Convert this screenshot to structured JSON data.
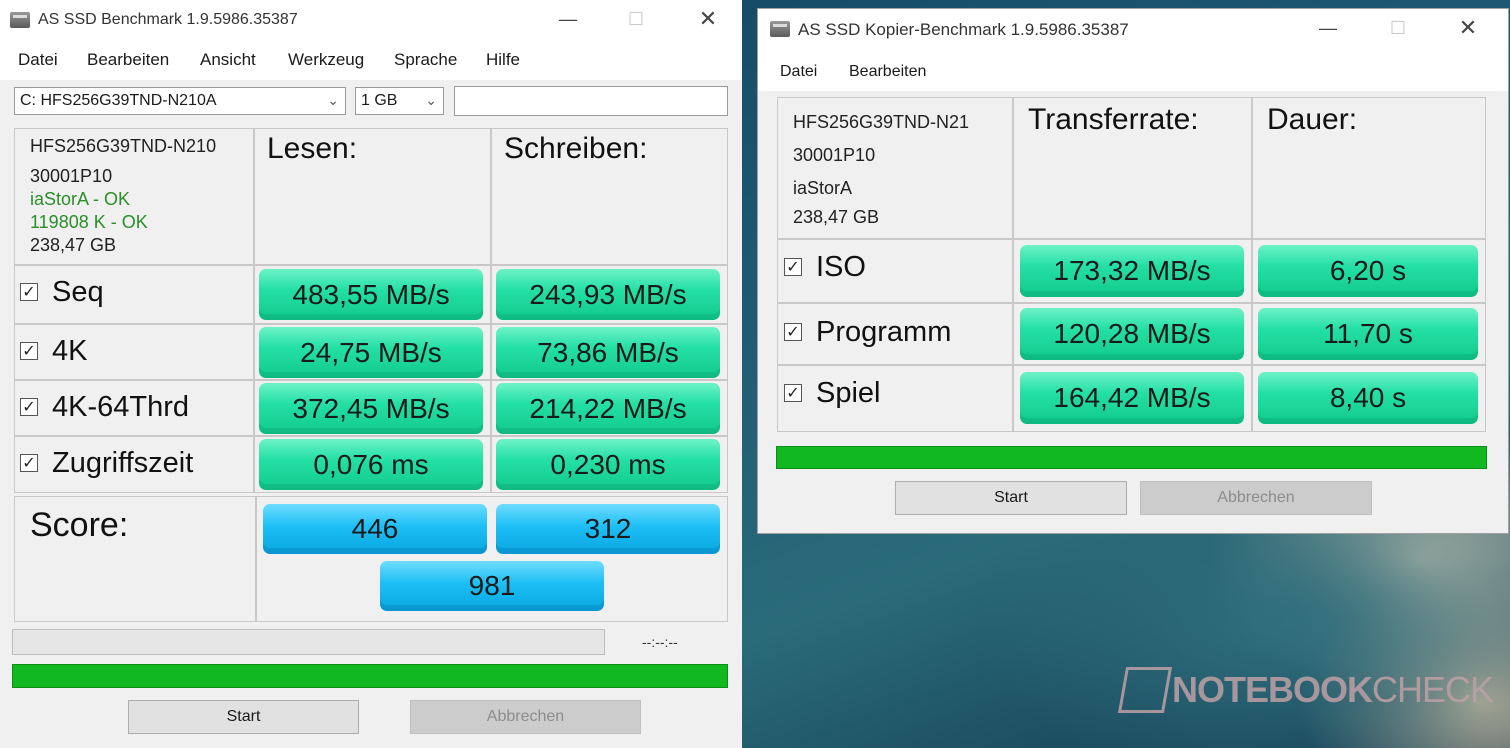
{
  "main": {
    "title": "AS SSD Benchmark 1.9.5986.35387",
    "menu": [
      "Datei",
      "Bearbeiten",
      "Ansicht",
      "Werkzeug",
      "Sprache",
      "Hilfe"
    ],
    "drive_select": "C: HFS256G39TND-N210A",
    "size_select": "1 GB",
    "search_value": "",
    "info": {
      "model": "HFS256G39TND-N210",
      "firmware": "30001P10",
      "driver": "iaStorA - OK",
      "alignment": "119808 K - OK",
      "capacity": "238,47 GB"
    },
    "headers": {
      "read": "Lesen:",
      "write": "Schreiben:"
    },
    "rows": [
      {
        "label": "Seq",
        "read": "483,55 MB/s",
        "write": "243,93 MB/s"
      },
      {
        "label": "4K",
        "read": "24,75 MB/s",
        "write": "73,86 MB/s"
      },
      {
        "label": "4K-64Thrd",
        "read": "372,45 MB/s",
        "write": "214,22 MB/s"
      },
      {
        "label": "Zugriffszeit",
        "read": "0,076 ms",
        "write": "0,230 ms"
      }
    ],
    "score_label": "Score:",
    "score": {
      "read": "446",
      "write": "312",
      "total": "981"
    },
    "time_display": "--:--:--",
    "buttons": {
      "start": "Start",
      "cancel": "Abbrechen"
    }
  },
  "copy": {
    "title": "AS SSD Kopier-Benchmark 1.9.5986.35387",
    "menu": [
      "Datei",
      "Bearbeiten"
    ],
    "info": {
      "model": "HFS256G39TND-N21",
      "firmware": "30001P10",
      "driver": "iaStorA",
      "capacity": "238,47 GB"
    },
    "headers": {
      "rate": "Transferrate:",
      "duration": "Dauer:"
    },
    "rows": [
      {
        "label": "ISO",
        "rate": "173,32 MB/s",
        "duration": "6,20 s"
      },
      {
        "label": "Programm",
        "rate": "120,28 MB/s",
        "duration": "11,70 s"
      },
      {
        "label": "Spiel",
        "rate": "164,42 MB/s",
        "duration": "8,40 s"
      }
    ],
    "buttons": {
      "start": "Start",
      "cancel": "Abbrechen"
    }
  },
  "watermark": {
    "bold": "NOTEBOOK",
    "light": "CHECK"
  },
  "colors": {
    "result_green": "#24e0a4",
    "score_blue": "#1cbff5",
    "progress_green": "#12b81f",
    "ok_text": "#2a8f2a"
  }
}
